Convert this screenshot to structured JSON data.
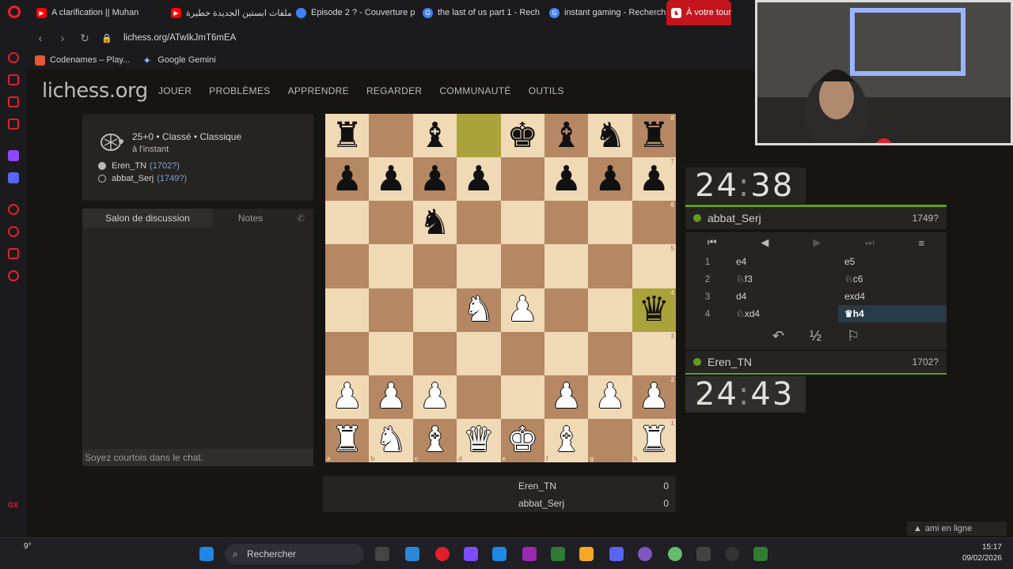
{
  "browser": {
    "tabs": [
      {
        "label": "A clarification || Muhan",
        "icon_color": "#ff0000"
      },
      {
        "label": "ملفات ابستين الجديدة خطيرة",
        "icon_color": "#ff0000"
      },
      {
        "label": "Episode 2 ? - Couverture p",
        "icon_color": "#3b82f6"
      },
      {
        "label": "the last of us part 1 - Rech",
        "icon_color": "#4285f4"
      },
      {
        "label": "instant gaming - Recherch",
        "icon_color": "#4285f4"
      },
      {
        "label": "À votre tour",
        "icon_color": "#ffffff"
      }
    ],
    "url": "lichess.org/ATwIkJmT6mEA",
    "bookmarks": [
      {
        "label": "Codenames – Play...",
        "icon_color": "#e25a36"
      },
      {
        "label": "Google Gemini",
        "icon_color": "#8ab4f8"
      }
    ]
  },
  "site": {
    "logo": "lichess.org",
    "nav": [
      "JOUER",
      "PROBLÈMES",
      "APPRENDRE",
      "REGARDER",
      "COMMUNAUTÉ",
      "OUTILS"
    ]
  },
  "game": {
    "mode": "25+0 • Classé • Classique",
    "when": "à l'instant",
    "white_name": "Eren_TN",
    "white_rating": "(1702?)",
    "black_name": "abbat_Serj",
    "black_rating": "(1749?)"
  },
  "chat": {
    "tab_chat": "Salon de discussion",
    "tab_notes": "Notes",
    "placeholder": "Soyez courtois dans le chat."
  },
  "board": {
    "ranks": [
      [
        "r",
        "",
        "b",
        "",
        "k",
        "b",
        "n",
        "r"
      ],
      [
        "p",
        "p",
        "p",
        "p",
        "",
        "p",
        "p",
        "p"
      ],
      [
        "",
        "",
        "n",
        "",
        "",
        "",
        "",
        ""
      ],
      [
        "",
        "",
        "",
        "",
        "",
        "",
        "",
        ""
      ],
      [
        "",
        "",
        "",
        "N",
        "P",
        "",
        "",
        "q"
      ],
      [
        "",
        "",
        "",
        "",
        "",
        "",
        "",
        ""
      ],
      [
        "P",
        "P",
        "P",
        "",
        "",
        "P",
        "P",
        "P"
      ],
      [
        "R",
        "N",
        "B",
        "Q",
        "K",
        "B",
        "",
        "R"
      ]
    ],
    "highlight": [
      "d8",
      "h4"
    ],
    "rank_labels": [
      "8",
      "7",
      "6",
      "5",
      "4",
      "3",
      "2",
      "1"
    ],
    "file_labels": [
      "a",
      "b",
      "c",
      "d",
      "e",
      "f",
      "g",
      "h"
    ]
  },
  "clocks": {
    "top_min": "24",
    "top_sec": "38",
    "bottom_min": "24",
    "bottom_sec": "43"
  },
  "players": {
    "top_name": "abbat_Serj",
    "top_rating": "1749?",
    "bottom_name": "Eren_TN",
    "bottom_rating": "1702?"
  },
  "moves": [
    {
      "n": "1",
      "w": "e4",
      "b": "e5"
    },
    {
      "n": "2",
      "w": "♘f3",
      "b": "♘c6"
    },
    {
      "n": "3",
      "w": "d4",
      "b": "exd4"
    },
    {
      "n": "4",
      "w": "♘xd4",
      "b": "♛h4"
    }
  ],
  "actions": {
    "takeback": "↶",
    "draw": "½",
    "resign": "⚐"
  },
  "score": {
    "p1": "Eren_TN",
    "p1_score": "0",
    "p2": "abbat_Serj",
    "p2_score": "0"
  },
  "online": "ami en ligne",
  "taskbar": {
    "search": "Rechercher",
    "temp": "9°",
    "time": "15:17",
    "date": "09/02/2026"
  },
  "colors": {
    "light_square": "#f0d9b5",
    "dark_square": "#b58863",
    "highlight": "#aaa23a",
    "online_green": "#629924",
    "active_tab": "#c4141c"
  }
}
